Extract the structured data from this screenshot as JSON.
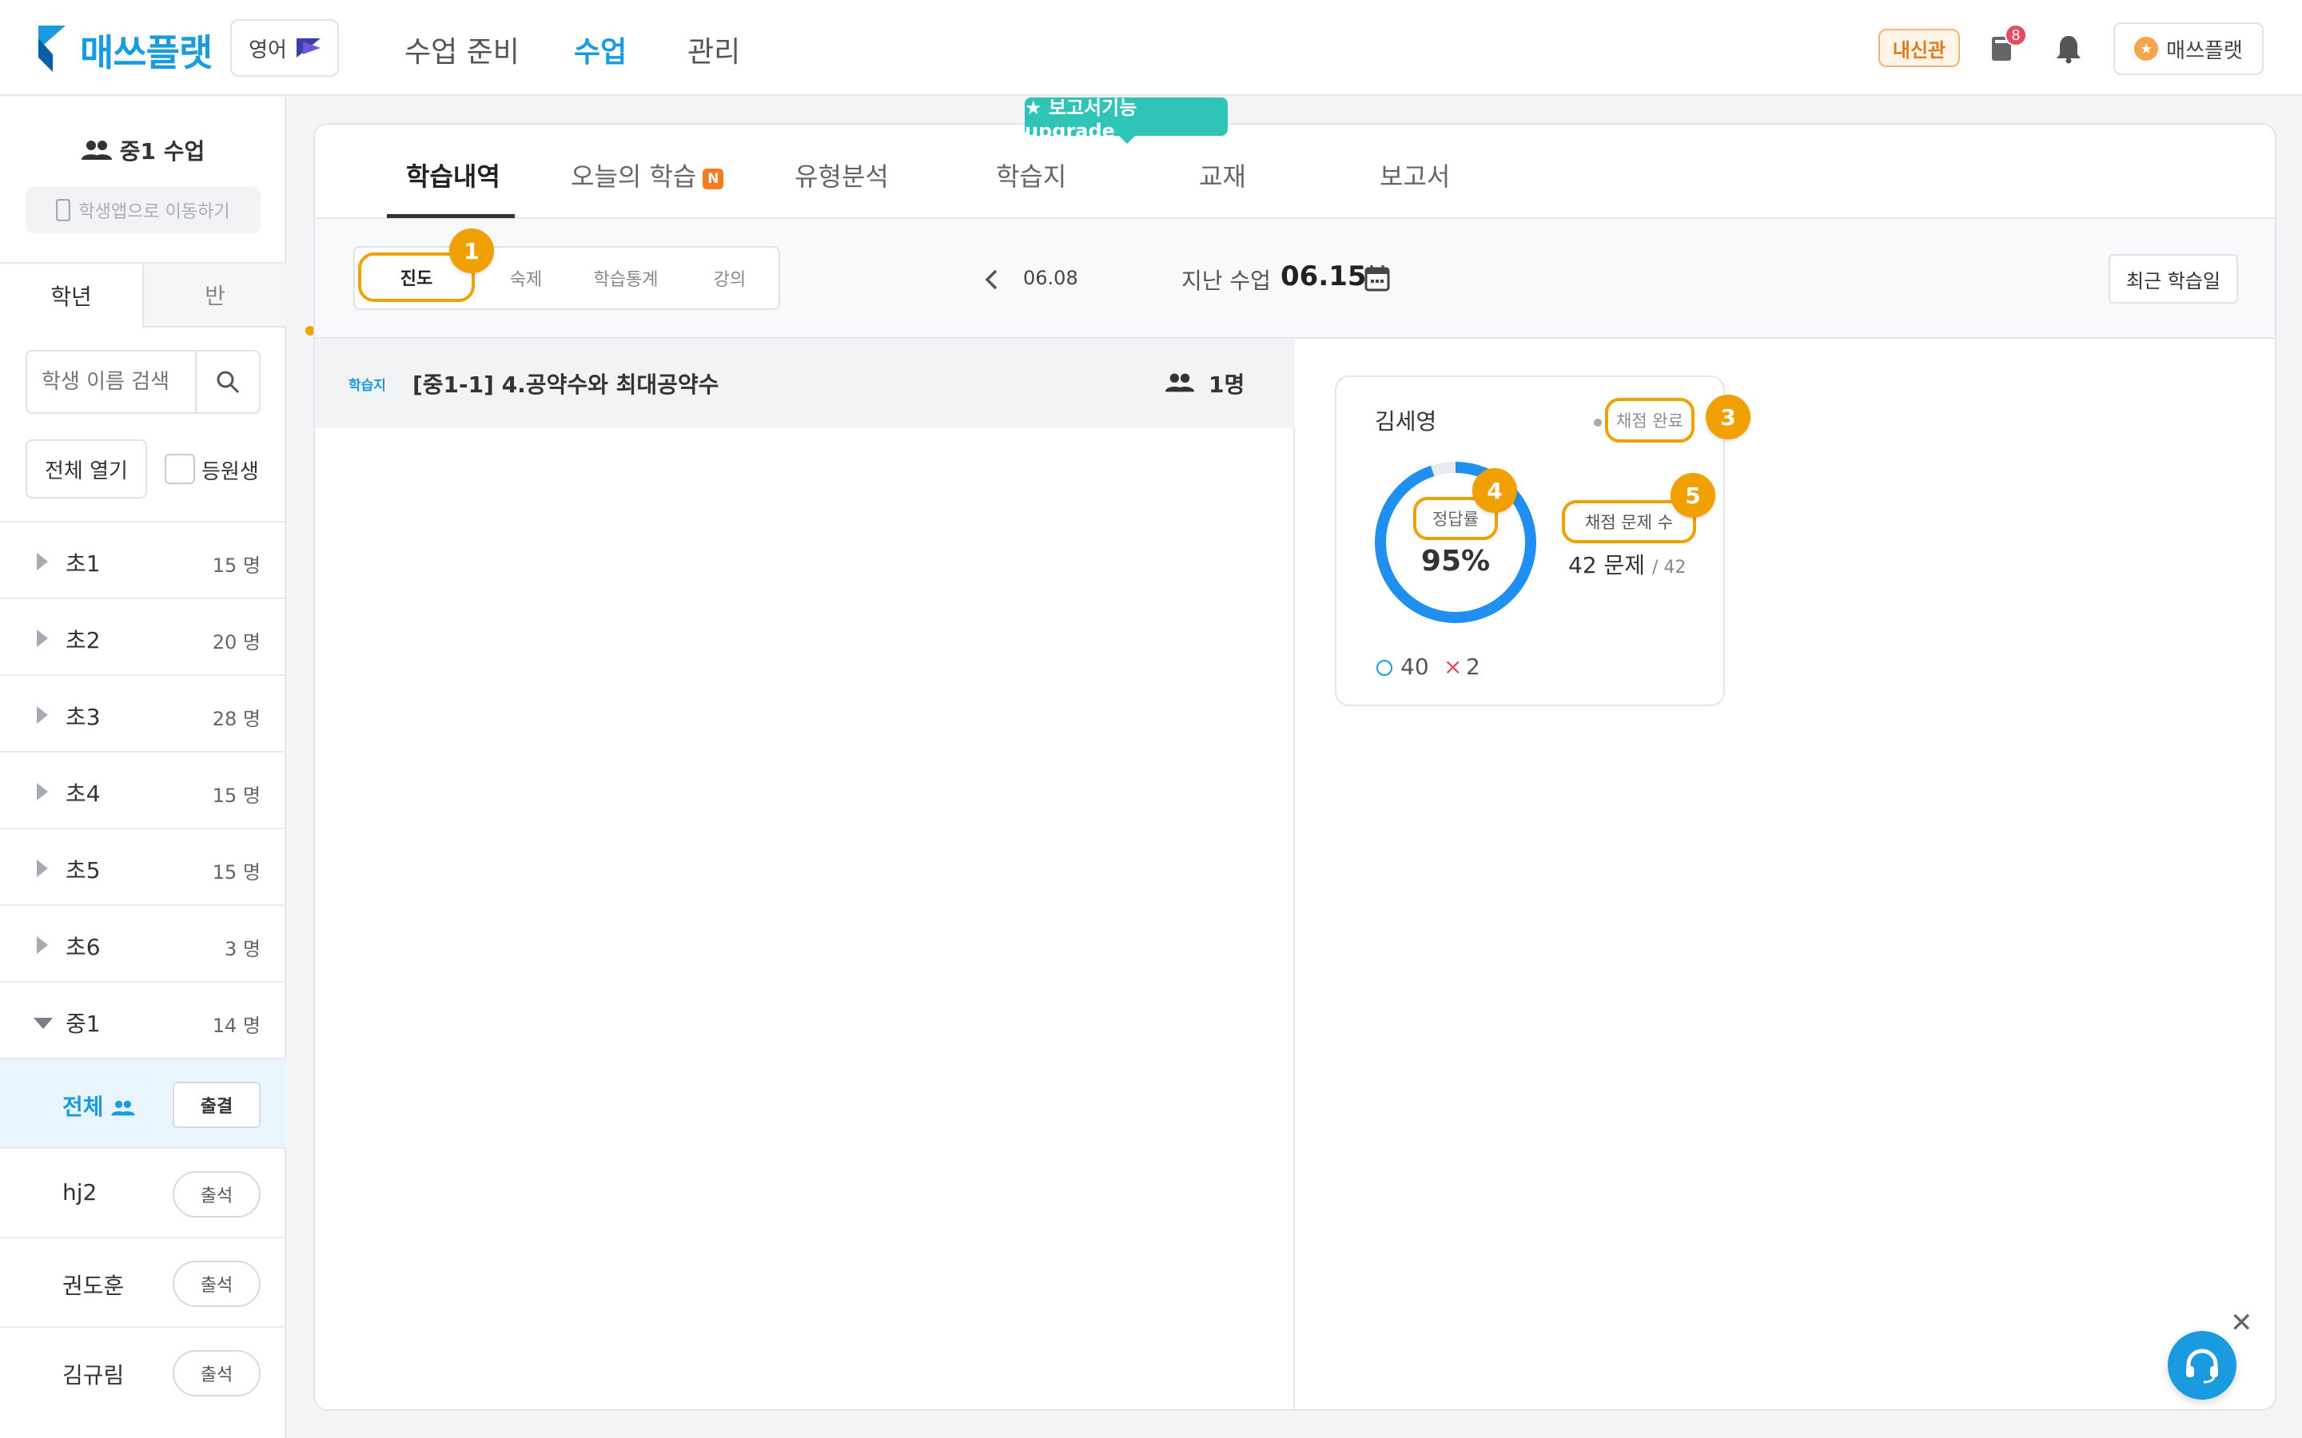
{
  "header": {
    "logo_text": "매쓰플랫",
    "subject": "영어",
    "nav": [
      {
        "label": "수업 준비",
        "active": false
      },
      {
        "label": "수업",
        "active": true
      },
      {
        "label": "관리",
        "active": false
      }
    ],
    "naesin_badge": "내신관",
    "notification_count": "8",
    "profile_name": "매쓰플랫",
    "brand_color": "#1a9be0"
  },
  "sidebar": {
    "class_title": "중1 수업",
    "student_app_button": "학생앱으로 이동하기",
    "tabs": [
      "학년",
      "반"
    ],
    "search_placeholder": "학생 이름 검색",
    "open_all_button": "전체 열기",
    "enrolled_label": "등원생",
    "grades": [
      {
        "name": "초1",
        "count": "15 명"
      },
      {
        "name": "초2",
        "count": "20 명"
      },
      {
        "name": "초3",
        "count": "28 명"
      },
      {
        "name": "초4",
        "count": "15 명"
      },
      {
        "name": "초5",
        "count": "15 명"
      },
      {
        "name": "초6",
        "count": "3 명"
      },
      {
        "name": "중1",
        "count": "14 명"
      }
    ],
    "all_label": "전체",
    "all_button": "출결",
    "students": [
      {
        "name": "hj2",
        "button": "출석"
      },
      {
        "name": "권도훈",
        "button": "출석"
      },
      {
        "name": "김규림",
        "button": "출석"
      }
    ]
  },
  "main": {
    "upgrade_badge": "★ 보고서기능 upgrade",
    "tabs": [
      "학습내역",
      "오늘의 학습",
      "유형분석",
      "학습지",
      "교재",
      "보고서"
    ],
    "new_badge": "N",
    "segments": [
      "진도",
      "숙제",
      "학습통계",
      "강의"
    ],
    "prev_date": "06.08",
    "last_class_label": "지난 수업",
    "last_class_date": "06.15",
    "recent_button": "최근 학습일",
    "lesson": {
      "type": "학습지",
      "title": "[중1-1] 4.공약수와 최대공약수",
      "count": "1명"
    },
    "student_card": {
      "name": "김세영",
      "status": "채점 완료",
      "rate_label": "정답률",
      "rate_value": "95%",
      "rate_fraction": 0.95,
      "graded_label": "채점 문제 수",
      "graded_value": "42 문제",
      "graded_total": "/ 42",
      "correct": "40",
      "wrong": "2"
    },
    "markers": [
      "1",
      "3",
      "4",
      "5"
    ]
  }
}
